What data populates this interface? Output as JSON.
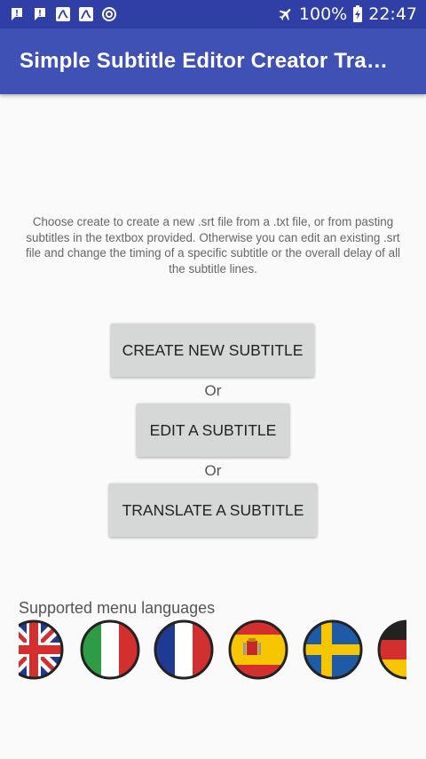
{
  "status_bar": {
    "battery": "100%",
    "time": "22:47",
    "icons": [
      "alert-notification-icon",
      "alert-notification-icon",
      "pdf-app-icon",
      "pdf-app-icon",
      "sync-app-icon",
      "airplane-mode-icon",
      "battery-charging-icon"
    ]
  },
  "app_bar": {
    "title": "Simple Subtitle Editor Creator Tra…"
  },
  "main": {
    "description": "Choose create to create a new .srt file from a .txt file, or from pasting subtitles in the textbox provided. Otherwise you can edit an existing .srt file and change the timing of a specific subtitle or the overall delay of all the subtitle lines.",
    "create_button": "CREATE NEW SUBTITLE",
    "or_1": "Or",
    "edit_button": "EDIT A SUBTITLE",
    "or_2": "Or",
    "translate_button": "TRANSLATE A SUBTITLE"
  },
  "languages": {
    "label": "Supported menu languages",
    "flags": [
      "uk-flag-icon",
      "italy-flag-icon",
      "france-flag-icon",
      "spain-flag-icon",
      "sweden-flag-icon",
      "germany-flag-icon"
    ]
  },
  "colors": {
    "status_bar": "#2f3fa5",
    "app_bar": "#3f51b5",
    "button": "#d6d7d7",
    "background": "#fafafa"
  }
}
